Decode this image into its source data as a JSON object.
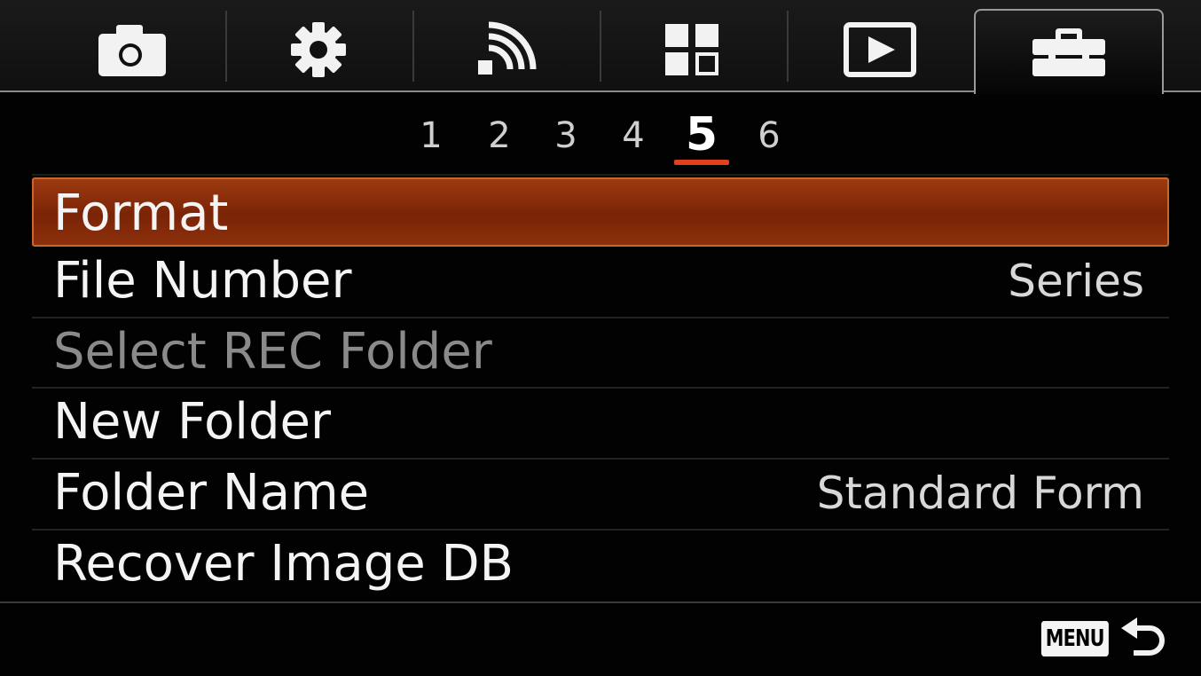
{
  "tabs": [
    {
      "icon": "camera-icon",
      "active": false
    },
    {
      "icon": "gear-icon",
      "active": false
    },
    {
      "icon": "wireless-icon",
      "active": false
    },
    {
      "icon": "application-grid-icon",
      "active": false
    },
    {
      "icon": "playback-icon",
      "active": false
    },
    {
      "icon": "toolbox-icon",
      "active": true
    }
  ],
  "pages": [
    "1",
    "2",
    "3",
    "4",
    "5",
    "6"
  ],
  "active_page": "5",
  "menu": {
    "items": [
      {
        "label": "Format",
        "value": "",
        "selected": true,
        "disabled": false
      },
      {
        "label": "File Number",
        "value": "Series",
        "selected": false,
        "disabled": false
      },
      {
        "label": "Select REC Folder",
        "value": "",
        "selected": false,
        "disabled": true
      },
      {
        "label": "New Folder",
        "value": "",
        "selected": false,
        "disabled": false
      },
      {
        "label": "Folder Name",
        "value": "Standard Form",
        "selected": false,
        "disabled": false
      },
      {
        "label": "Recover Image DB",
        "value": "",
        "selected": false,
        "disabled": false
      }
    ]
  },
  "footer": {
    "menu_button_label": "MENU",
    "back_icon": "return-arrow-icon"
  },
  "colors": {
    "accent": "#e0401c",
    "selected_row": "#8a2d08",
    "disabled_text": "#8a8a8a"
  }
}
